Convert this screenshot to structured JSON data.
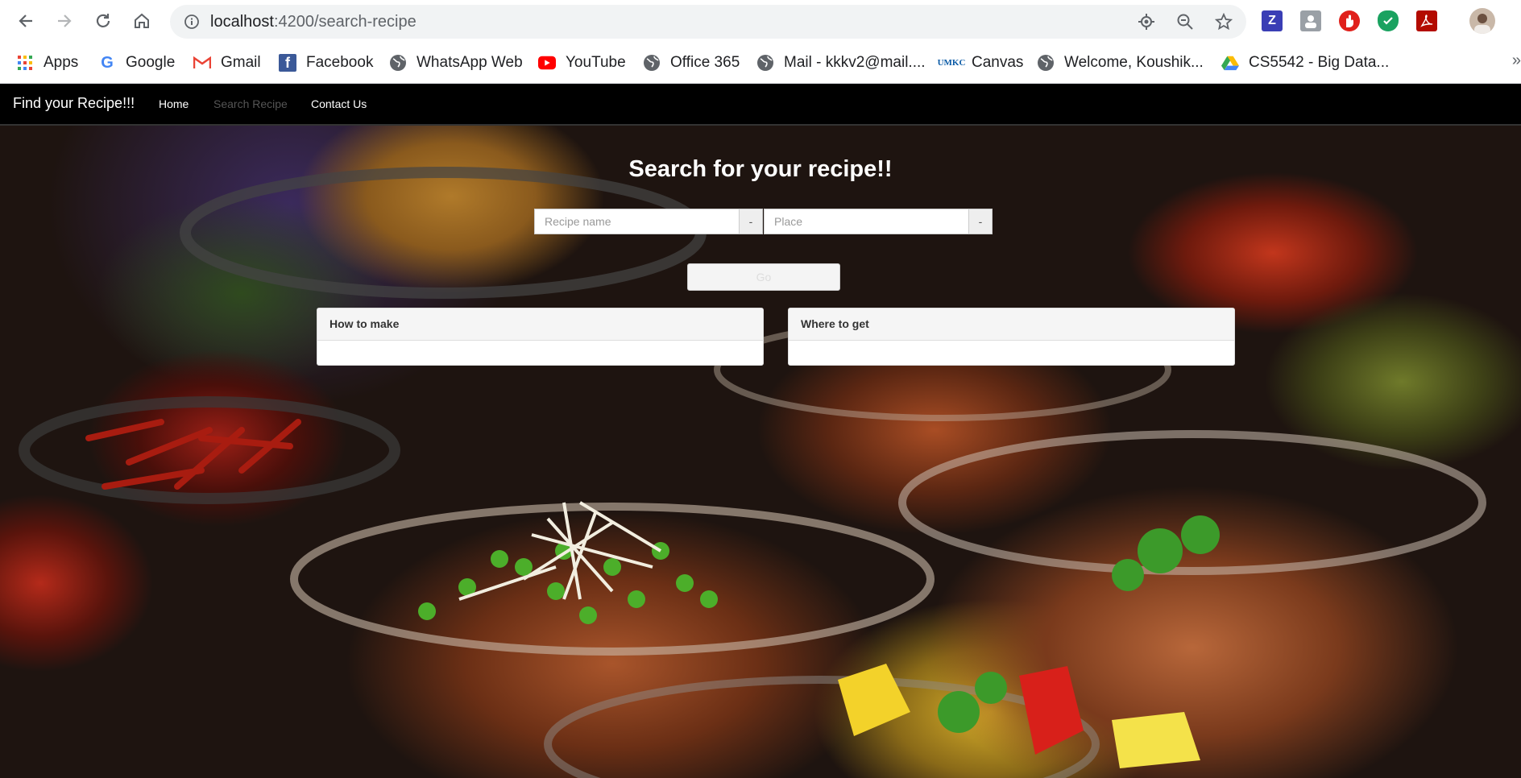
{
  "browser": {
    "url_host": "localhost",
    "url_path": ":4200/search-recipe",
    "bookmarks": [
      {
        "label": "Apps",
        "icon": "apps-grid-icon"
      },
      {
        "label": "Google",
        "icon": "google-icon"
      },
      {
        "label": "Gmail",
        "icon": "gmail-icon"
      },
      {
        "label": "Facebook",
        "icon": "facebook-icon"
      },
      {
        "label": "WhatsApp Web",
        "icon": "globe-icon"
      },
      {
        "label": "YouTube",
        "icon": "youtube-icon"
      },
      {
        "label": "Office 365",
        "icon": "globe-icon"
      },
      {
        "label": "Mail - kkkv2@mail....",
        "icon": "globe-icon"
      },
      {
        "label": "Canvas",
        "icon": "umkc-icon"
      },
      {
        "label": "Welcome, Koushik...",
        "icon": "globe-icon"
      },
      {
        "label": "CS5542 - Big Data...",
        "icon": "google-drive-icon"
      }
    ],
    "more_label": "»"
  },
  "nav": {
    "brand": "Find your Recipe!!!",
    "links": [
      {
        "label": "Home",
        "active": false
      },
      {
        "label": "Search Recipe",
        "active": true
      },
      {
        "label": "Contact Us",
        "active": false
      }
    ]
  },
  "search": {
    "heading": "Search for your recipe!!",
    "recipe_placeholder": "Recipe name",
    "recipe_addon": "-",
    "place_placeholder": "Place",
    "place_addon": "-",
    "go_label": "Go"
  },
  "panels": {
    "how_to_make": "How to make",
    "where_to_get": "Where to get"
  },
  "colors": {
    "navbar_bg": "#000000",
    "nav_active": "#555555"
  }
}
